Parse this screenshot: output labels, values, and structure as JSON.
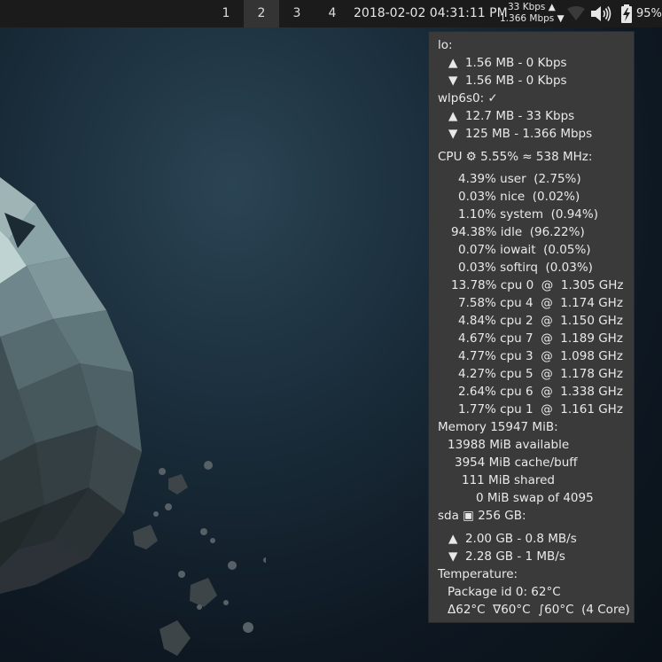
{
  "topbar": {
    "workspaces": [
      "1",
      "2",
      "3",
      "4"
    ],
    "active_workspace": "2",
    "clock": "2018-02-02 04:31:11 PM",
    "net_up": "33 Kbps ▲",
    "net_down": "1.366 Mbps ▼",
    "battery": "95%",
    "icons": [
      "wifi-icon",
      "volume-icon",
      "battery-charging-icon"
    ]
  },
  "panel": {
    "lo_label": "lo:",
    "lo_up": "▲  1.56 MB - 0 Kbps",
    "lo_down": "▼  1.56 MB - 0 Kbps",
    "wlp_label": "wlp6s0: ✓",
    "wlp_up": "▲  12.7 MB - 33 Kbps",
    "wlp_down": "▼  125 MB - 1.366 Mbps",
    "cpu_label": "CPU ⚙ 5.55% ≈ 538 MHz:",
    "cpu_user": "4.39% user  (2.75%)",
    "cpu_nice": "0.03% nice  (0.02%)",
    "cpu_system": "1.10% system  (0.94%)",
    "cpu_idle": "94.38% idle  (96.22%)",
    "cpu_iowait": "0.07% iowait  (0.05%)",
    "cpu_softirq": "0.03% softirq  (0.03%)",
    "cpu0": "13.78% cpu 0  @  1.305 GHz",
    "cpu4": "7.58% cpu 4  @  1.174 GHz",
    "cpu2": "4.84% cpu 2  @  1.150 GHz",
    "cpu7": "4.67% cpu 7  @  1.189 GHz",
    "cpu3": "4.77% cpu 3  @  1.098 GHz",
    "cpu5": "4.27% cpu 5  @  1.178 GHz",
    "cpu6": "2.64% cpu 6  @  1.338 GHz",
    "cpu1": "1.77% cpu 1  @  1.161 GHz",
    "mem_label": "Memory 15947 MiB:",
    "mem_available": "13988 MiB available",
    "mem_cache": "3954 MiB cache/buff",
    "mem_shared": "111 MiB shared",
    "mem_swap": "0 MiB swap of 4095",
    "sda_label": "sda ▣ 256 GB:",
    "sda_read": "▲  2.00 GB - 0.8 MB/s",
    "sda_write": "▼  2.28 GB - 1 MB/s",
    "temp_label": "Temperature:",
    "temp_package": "Package id 0: 62°C",
    "temp_stats": "Δ62°C  ∇60°C  ∫60°C  (4 Core)"
  },
  "colors": {
    "topbar_bg": "#1b1b1b",
    "active_ws_bg": "#343434",
    "panel_bg": "#3a3a3a",
    "text": "#e9e9e9"
  }
}
